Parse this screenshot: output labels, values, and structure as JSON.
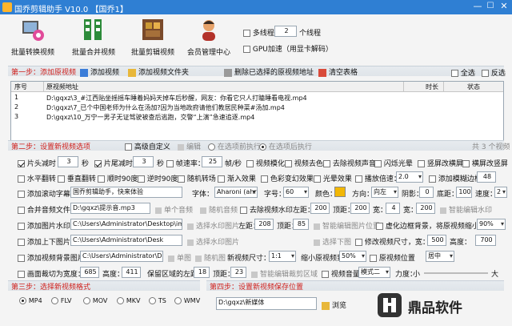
{
  "window": {
    "title": "国乔剪辑助手 V10.0  【国乔1】",
    "min": "—",
    "max": "☐",
    "close": "✕"
  },
  "toolbar": {
    "items": [
      {
        "label": "批量转换视频"
      },
      {
        "label": "批量合并视频"
      },
      {
        "label": "批量剪辑视频"
      },
      {
        "label": "会员管理中心"
      }
    ],
    "multithread_label": "多线程",
    "thread_count": "2",
    "thread_unit": "个线程",
    "gpu_label": "GPU加速（用显卡解码）"
  },
  "step1": {
    "title": "第一步：添加原视频",
    "add_video": "添加视频",
    "add_folder": "添加视频文件夹",
    "delete_selected": "删除已选择的原视频地址",
    "clear_table": "清空表格",
    "select_all": "全选",
    "invert": "反选"
  },
  "table": {
    "columns": [
      "序号",
      "原视频地址",
      "时长",
      "状态"
    ],
    "rows": [
      {
        "no": "1",
        "path": "D:\\gqxz\\3_#江西贴坐摇摇车睡着妈妈天掉车后秒醒，网友：你看它只人打瞌睡看电视.mp4"
      },
      {
        "no": "2",
        "path": "D:\\gqxz\\7_已个中国老师为什么在汤加?因为当地政府请他们教居民种菜#汤加.mp4"
      },
      {
        "no": "3",
        "path": "D:\\gqxz\\10_万宁一男子无证驾驶被查后逃跑，交警“上演”急速追逐.mp4"
      }
    ]
  },
  "step2": {
    "title": "第二步：设置新视频选项",
    "advanced": "高级自定义",
    "edit": "编辑",
    "pre_exec": "在选项前执行",
    "post_exec": "在选项后执行",
    "total": "共 3 个视频"
  },
  "opts": {
    "head_cut": "片头减时",
    "head_val": "3",
    "sec1": "秒",
    "tail_cut": "片尾减时",
    "tail_val": "3",
    "sec2": "秒",
    "fps_label": "帧速率：",
    "fps_val": "25",
    "fps_unit": "帧/秒",
    "blur": "视频模化",
    "decolor": "视频去色",
    "denoise": "去除视频声音",
    "flash": "闪烁光晕",
    "vscreen": "竖屏改横屏",
    "hscreen": "横屏改竖屏",
    "hflip": "水平翻转",
    "vflip": "垂直翻转",
    "rot90": "顺时90度",
    "rot_ccw": "逆时90度",
    "rand_transition": "随机转场",
    "fade": "渐入效果",
    "color_cast": "色彩变幻效果",
    "halo": "光晕效果",
    "speed": "播放倍速：",
    "speed_val": "2.0",
    "blur_edge": "添加模糊边框",
    "blur_edge_val": "48",
    "scroll_text": "添加滚动字幕",
    "scroll_placeholder": "国乔剪辑助手，快来体验",
    "font_label": "字体：",
    "font_val": "Aharoni (ahr",
    "size_label": "字号：",
    "size_val": "60",
    "color_label": "颜色：",
    "dir_label": "方向：",
    "dir_val": "向左",
    "shadow_label": "阴影：",
    "shadow_val": "0",
    "bottom_label": "底距：",
    "bottom_val": "100",
    "speed2_label": "速度：",
    "speed2_val": "2",
    "merge_audio": "合并音频文件",
    "audio_path": "D:\\gqxz\\提示音.mp3",
    "single_audio": "单个音频",
    "rand_audio": "随机音频",
    "remove_watermark": "去除视频水印",
    "left_label": "左距：",
    "left_val": "200",
    "top_label": "顶距：",
    "top_val": "200",
    "wide_label": "宽：",
    "wide_val": "4",
    "high_label": "宽：",
    "high_val": "200",
    "smart_wm": "智能编辑水印",
    "add_image_wm": "添加图片水印",
    "image_wm_path": "C:\\Users\\Administrator\\Desktop\\img-g",
    "select_image": "选择水印图片",
    "left2_label": "左距：",
    "left2_val": "208",
    "top2_label": "顶距：",
    "top2_val": "85",
    "smart_pos": "智能编辑图片位置",
    "virtual_border": "虚化边框背景，将原视频缩小到：",
    "scale_val": "90%",
    "add_headtail": "添加上下图片水印",
    "headtail_path": "C:\\Users\\Administrator\\Desk",
    "select_watermark": "选择水印图片",
    "select_bg": "选择下图",
    "resize": "修改视频尺寸，宽：",
    "width_val": "500",
    "height_label": "高度：",
    "height_val": "700",
    "add_bg": "添加视频背景图片",
    "bg_path": "C:\\Users\\Administrator\\D",
    "single": "单图",
    "rand_img": "随机图",
    "new_size": "新视频尺寸：",
    "new_size_val": "1:1",
    "shrink": "缩小原视频到",
    "shrink_val": "50%",
    "orig_pos": "原视频位置",
    "pos_val": "居中",
    "crop": "画面裁切为宽度：",
    "crop_w": "685",
    "crop_h_label": "高度：",
    "crop_h": "411",
    "keep_left": "保留区域的左距：",
    "keep_left_val": "18",
    "keep_top_label": "顶距：",
    "keep_top_val": "23",
    "smart_crop": "智能编辑裁剪区域",
    "volume": "视频音量",
    "mode_val": "模式二",
    "power": "力度：",
    "small": "小",
    "large": "大"
  },
  "step3": {
    "title": "第三步：选择新视频格式",
    "formats": [
      "MP4",
      "FLV",
      "MOV",
      "MKV",
      "TS",
      "WMV"
    ],
    "selected": "MP4"
  },
  "step4": {
    "title": "第四步：设置新视频保存位置",
    "path": "D:\\gqxz\\新媒体",
    "browse": "浏览"
  },
  "watermark": {
    "brand": "鼎品软件"
  },
  "colors": {
    "titlebar": "#2f7fd3",
    "section": "#d0201c",
    "scroll_color": "#f2b705"
  }
}
